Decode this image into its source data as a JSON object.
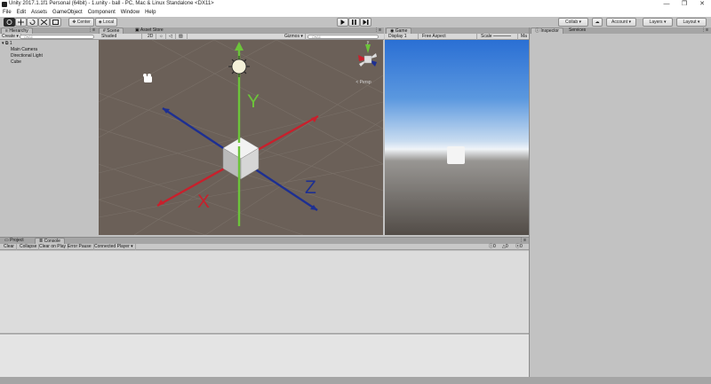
{
  "window": {
    "title": "Unity 2017.1.1f1 Personal (64bit) - 1.unity - ball - PC, Mac & Linux Standalone <DX11>",
    "controls": [
      "—",
      "❐",
      "✕"
    ]
  },
  "menu": [
    "File",
    "Edit",
    "Assets",
    "GameObject",
    "Component",
    "Window",
    "Help"
  ],
  "toolbar": {
    "pivot": "Center",
    "space": "Local",
    "collab": "Collab ▾",
    "account": "Account ▾",
    "layers": "Layers ▾",
    "layout": "Layout ▾"
  },
  "hierarchy": {
    "tab": "Hierarchy",
    "create": "Create ▾",
    "search_placeholder": "Q▾All",
    "scene_name": "1",
    "items": [
      "Main Camera",
      "Directional Light",
      "Cube"
    ]
  },
  "scene": {
    "tabs": [
      "Scene",
      "Asset Store"
    ],
    "shading": "Shaded",
    "mode2d": "2D",
    "gizmos": "Gizmos ▾",
    "search_placeholder": "Q▾All",
    "axis_x": "X",
    "axis_y": "Y",
    "axis_z": "Z",
    "gizmo_y": "y",
    "gizmo_persp": "< Persp"
  },
  "game": {
    "tab": "Game",
    "display": "Display 1",
    "aspect": "Free Aspect",
    "scale": "Scale",
    "maximize": "Ma"
  },
  "inspector": {
    "tabs": [
      "Inspector",
      "Services"
    ]
  },
  "console": {
    "tabs": [
      "Project",
      "Console"
    ],
    "buttons": [
      "Clear",
      "Collapse",
      "Clear on Play",
      "Error Pause",
      "Connected Player ▾"
    ],
    "counts": [
      "0",
      "0",
      "0"
    ]
  },
  "colors": {
    "x_axis": "#c8202c",
    "y_axis": "#6cc43a",
    "z_axis": "#1d2f92",
    "scene_bg": "#6b6058"
  }
}
